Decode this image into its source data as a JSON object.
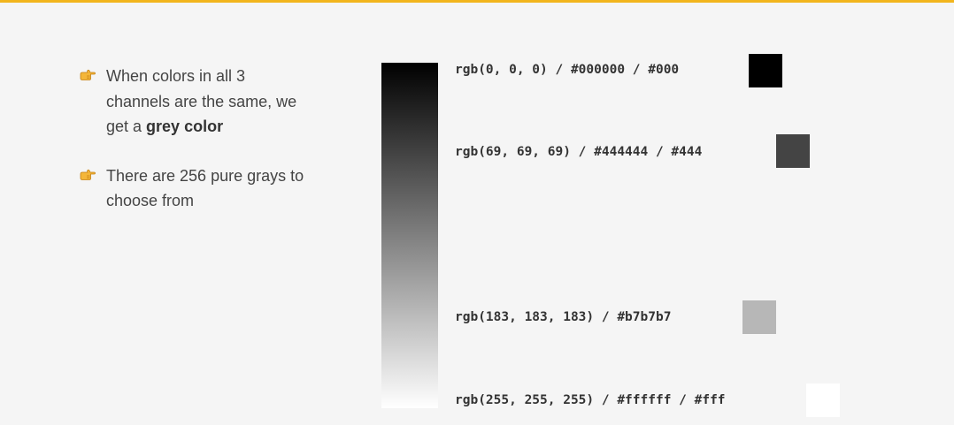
{
  "theme": {
    "accent": "#f2b51c",
    "background": "#f5f5f5"
  },
  "bullets": [
    {
      "icon": "backhand-index-pointing-right-icon",
      "text_before": "When colors in all 3 channels are the same, we get a ",
      "emphasis": "grey color",
      "text_after": ""
    },
    {
      "icon": "backhand-index-pointing-right-icon",
      "text_before": "There are 256 pure grays to choose from",
      "emphasis": "",
      "text_after": ""
    }
  ],
  "gradient": {
    "from": "#000000",
    "to": "#ffffff"
  },
  "swatches": [
    {
      "label": "rgb(0, 0, 0) / #000000 / #000",
      "color": "#000000"
    },
    {
      "label": "rgb(69, 69, 69) / #444444 / #444",
      "color": "#444444"
    },
    {
      "label": "rgb(183, 183, 183) / #b7b7b7",
      "color": "#b7b7b7"
    },
    {
      "label": "rgb(255, 255, 255) / #ffffff / #fff",
      "color": "#ffffff"
    }
  ]
}
